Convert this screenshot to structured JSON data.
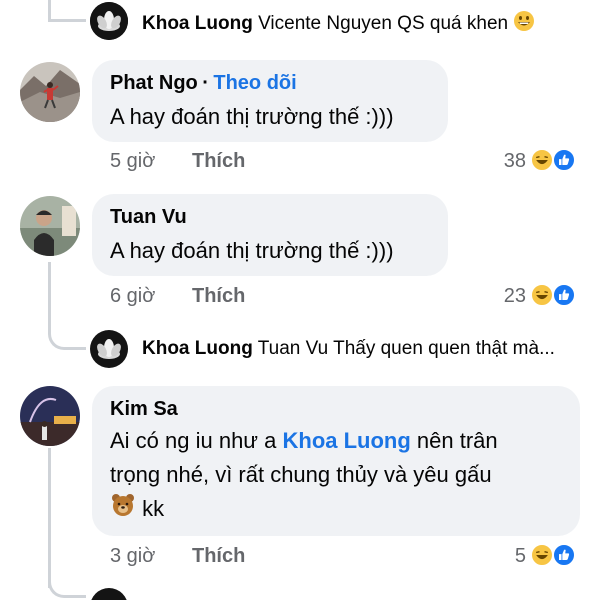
{
  "replies": [
    {
      "author": "Khoa Luong",
      "text": "Vicente Nguyen QS quá khen",
      "emoji": "grinning-face-icon"
    },
    {
      "author": "Khoa Luong",
      "text": "Tuan Vu Thấy quen quen thật mà..."
    }
  ],
  "comments": [
    {
      "author": "Phat Ngo",
      "separator": "·",
      "follow_label": "Theo dõi",
      "text": "A hay đoán thị trường thế :)))",
      "time": "5 giờ",
      "like_label": "Thích",
      "reaction_count": "38"
    },
    {
      "author": "Tuan Vu",
      "text": "A hay đoán thị trường thế :)))",
      "time": "6 giờ",
      "like_label": "Thích",
      "reaction_count": "23"
    },
    {
      "author": "Kim Sa",
      "text_before": "Ai có ng iu như a ",
      "mention": "Khoa Luong",
      "text_after_1": " nên trân",
      "text_line2": "trọng nhé, vì rất chung thủy và yêu gấu",
      "text_line3": "kk",
      "emoji": "bear-face-icon",
      "time": "3 giờ",
      "like_label": "Thích",
      "reaction_count": "5"
    }
  ],
  "colors": {
    "bubble": "#f0f2f5",
    "link": "#1b74e4",
    "meta": "#65676b",
    "like_blue": "#1877f2",
    "haha_yellow": "#f7c544"
  }
}
